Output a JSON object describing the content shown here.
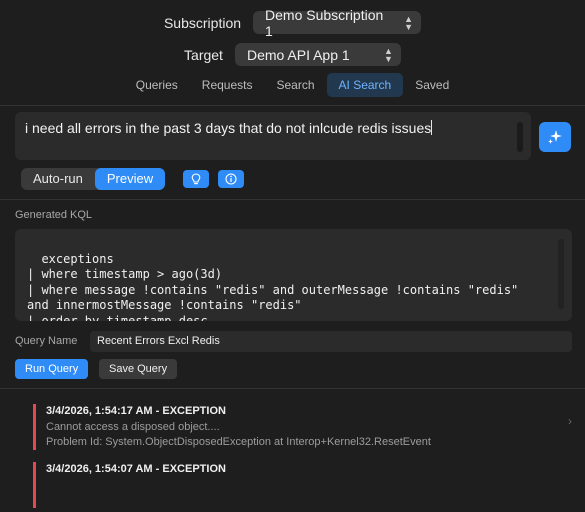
{
  "header": {
    "subscription_label": "Subscription",
    "subscription_value": "Demo Subscription 1",
    "target_label": "Target",
    "target_value": "Demo API App 1"
  },
  "tabs": [
    {
      "label": "Queries",
      "active": false
    },
    {
      "label": "Requests",
      "active": false
    },
    {
      "label": "Search",
      "active": false
    },
    {
      "label": "AI Search",
      "active": true
    },
    {
      "label": "Saved",
      "active": false
    }
  ],
  "prompt": {
    "text": "i need all errors in the past 3 days that do not inlcude redis issues"
  },
  "mode": {
    "auto_run": "Auto-run",
    "preview": "Preview",
    "selected": "Preview"
  },
  "kql": {
    "label": "Generated KQL",
    "code": "exceptions\n| where timestamp > ago(3d)\n| where message !contains \"redis\" and outerMessage !contains \"redis\"\nand innermostMessage !contains \"redis\"\n| order by timestamp desc"
  },
  "query_name": {
    "label": "Query Name",
    "value": "Recent Errors Excl Redis"
  },
  "buttons": {
    "run": "Run Query",
    "save": "Save Query"
  },
  "results": [
    {
      "title": "3/4/2026, 1:54:17 AM - EXCEPTION",
      "message": "Cannot access a disposed object....",
      "problem": "Problem Id: System.ObjectDisposedException at Interop+Kernel32.ResetEvent"
    },
    {
      "title": "3/4/2026, 1:54:07 AM - EXCEPTION",
      "message": "",
      "problem": ""
    }
  ],
  "colors": {
    "accent": "#2f8cf7",
    "error_bar": "#e5484d",
    "background": "#1e1e1e"
  },
  "icons": {
    "generate": "sparkle-icon",
    "tip": "lightbulb-icon",
    "info": "info-icon"
  }
}
